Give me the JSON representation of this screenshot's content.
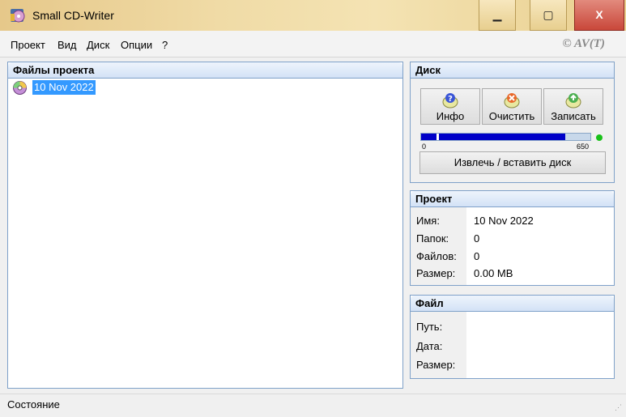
{
  "window": {
    "title": "Small CD-Writer",
    "minimize_glyph": "▁",
    "maximize_glyph": "▢",
    "close_glyph": "X"
  },
  "menu": {
    "items": [
      "Проект",
      "Вид",
      "Диск",
      "Опции",
      "?"
    ],
    "copyright": "© AV(T)"
  },
  "files_panel": {
    "title": "Файлы проекта",
    "items": [
      {
        "label": "10 Nov 2022",
        "icon": "cd-icon",
        "selected": true
      }
    ]
  },
  "disk_panel": {
    "title": "Диск",
    "buttons": [
      {
        "label": "Инфо",
        "icon": "info-disc-icon"
      },
      {
        "label": "Очистить",
        "icon": "erase-disc-icon"
      },
      {
        "label": "Записать",
        "icon": "burn-disc-icon"
      }
    ],
    "capacity": {
      "min_label": "0",
      "max_label": "650",
      "fill_fraction": 0.85
    },
    "eject_label": "Извлечь / вставить диск",
    "led_color": "#19c119"
  },
  "project_panel": {
    "title": "Проект",
    "fields": [
      {
        "label": "Имя:",
        "value": "10 Nov 2022"
      },
      {
        "label": "Папок:",
        "value": "0"
      },
      {
        "label": "Файлов:",
        "value": "0"
      },
      {
        "label": "Размер:",
        "value": "0.00 MB"
      }
    ]
  },
  "file_panel": {
    "title": "Файл",
    "fields": [
      {
        "label": "Путь:",
        "value": ""
      },
      {
        "label": "Дата:",
        "value": ""
      },
      {
        "label": "Размер:",
        "value": ""
      }
    ]
  },
  "status": {
    "text": "Состояние"
  },
  "colors": {
    "selection": "#3399ff",
    "panel_border": "#7fa1c9",
    "progress_fill": "#0000c8"
  }
}
